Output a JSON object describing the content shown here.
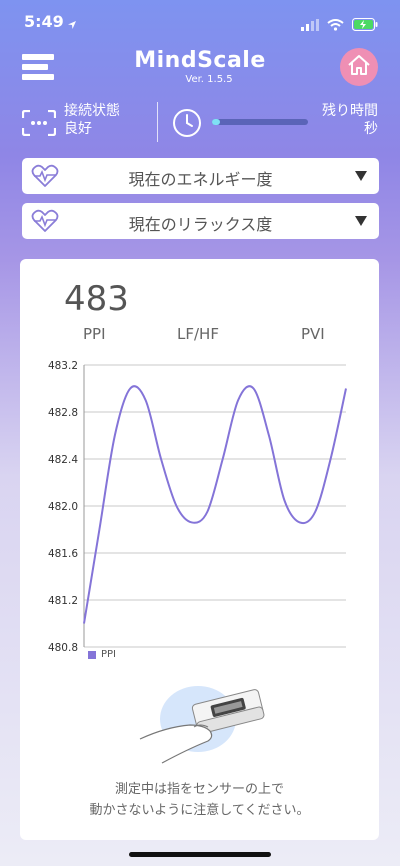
{
  "status": {
    "time": "5:49"
  },
  "header": {
    "title": "MindScale",
    "version": "Ver. 1.5.5"
  },
  "connection": {
    "label": "接続状態",
    "value": "良好"
  },
  "remaining": {
    "label": "残り時間",
    "unit": "秒",
    "progress": 0.08
  },
  "dropdowns": {
    "energy": "現在のエネルギー度",
    "relax": "現在のリラックス度"
  },
  "card": {
    "value": "483",
    "tabs": [
      "PPI",
      "LF/HF",
      "PVI"
    ],
    "legend": "PPI",
    "instruction_line1": "測定中は指をセンサーの上で",
    "instruction_line2": "動かさないように注意してください。"
  },
  "colors": {
    "accent": "#8474d8",
    "home": "#ef8fb4",
    "progress": "#7fe0f4"
  },
  "chart_data": {
    "type": "line",
    "ylim": [
      480.8,
      483.2
    ],
    "yticks": [
      "483.2",
      "482.8",
      "482.4",
      "482.0",
      "481.6",
      "481.2",
      "480.8"
    ],
    "grid": true,
    "legend_position": "bottom-left",
    "series": [
      {
        "name": "PPI",
        "color": "#8474d8",
        "values": [
          481.0,
          481.8,
          482.6,
          483.0,
          482.9,
          482.4,
          482.0,
          481.86,
          481.95,
          482.4,
          482.9,
          483.0,
          482.6,
          482.05,
          481.86,
          481.95,
          482.4,
          483.0
        ]
      }
    ]
  }
}
